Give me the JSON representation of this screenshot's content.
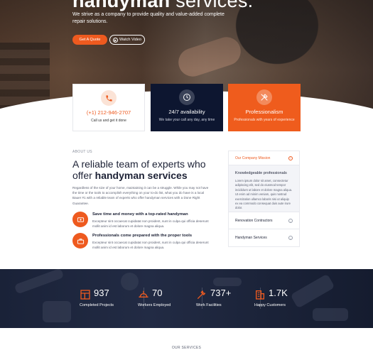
{
  "hero": {
    "title_bold": "handyman",
    "title_rest": "services.",
    "subtitle": "We strive as a company to provide quality and value-added complete repair solutions.",
    "quote_button": "Get A Quote",
    "video_button": "Watch Video"
  },
  "cards": [
    {
      "title": "(+1) 212-946-2707",
      "sub": "Call us and get it done",
      "icon": "phone-icon"
    },
    {
      "title": "24/7 availability",
      "sub": "We take your call any day, any time",
      "icon": "clock-icon"
    },
    {
      "title": "Professionalism",
      "sub": "Professionals with years of experience",
      "icon": "tools-icon"
    }
  ],
  "about": {
    "tag": "ABOUT US",
    "heading_line1": "A reliable team of experts who",
    "heading_offer": "offer",
    "heading_bold": "handyman services",
    "paragraph": "Regardless of the size of your home, maintaining it can be a struggle. While you may not have the time or the tools to accomplish everything on your to-do list, what you do have is a local Bauer #1 with a reliable team of experts who offer handyman services with a Done Right Guarantee.",
    "features": [
      {
        "title": "Save time and money with a top-rated handyman",
        "text": "Excepteur sint occaecat cupidatat non proident, sunt in culpa qui officia deserunt mollit anim id est laborum et dolore magna aliqua.",
        "icon": "money-icon"
      },
      {
        "title": "Professionals come prepared with the proper tools",
        "text": "Excepteur sint occaecat cupidatat non proident, sunt in culpa qui officia deserunt mollit anim id est laborum et dolore magna aliqua.",
        "icon": "toolbox-icon"
      }
    ]
  },
  "accordion": {
    "items": [
      {
        "label": "Our Company Mission",
        "open": true
      },
      {
        "label": "Renovation Contractors",
        "open": false
      },
      {
        "label": "Handyman Services",
        "open": false
      }
    ],
    "body_title": "Knowledgeable professionals",
    "body_text": "Lorem ipsum dolor sit amet, consectetur adipiscing elit, sed do eiusmod tempor incididunt ut labore et dolore magna aliqua. Ut enim ad minim veniam, quis nostrud exercitation ullamco laboris nisi ut aliquip ex ea commodo consequat duis aute irure dolor."
  },
  "stats": [
    {
      "number": "937",
      "label": "Completed Projects",
      "icon": "blueprint-icon"
    },
    {
      "number": "70",
      "label": "Workers Employed",
      "icon": "hardhat-icon"
    },
    {
      "number": "737+",
      "label": "Work Facilities",
      "icon": "wrench-icon"
    },
    {
      "number": "1.7K",
      "label": "Happy Customers",
      "icon": "building-icon"
    }
  ],
  "services": {
    "tag": "OUR SERVICES"
  },
  "colors": {
    "accent": "#ee5a1f",
    "navy": "#0d1630",
    "stats_bg": "#1a2238"
  }
}
